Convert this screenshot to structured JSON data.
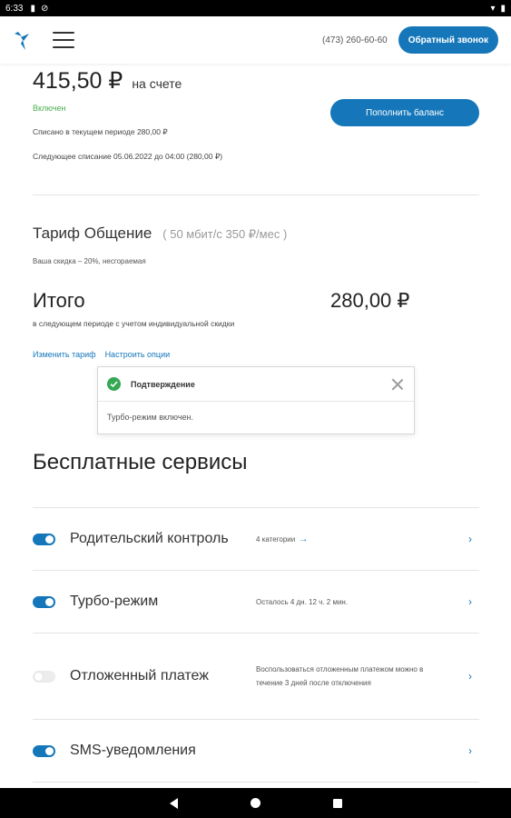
{
  "status_bar": {
    "time": "6:33"
  },
  "header": {
    "phone": "(473) 260-60-60",
    "callback_label": "Обратный звонок"
  },
  "account": {
    "balance": "415,50 ₽",
    "balance_suffix": "на счете",
    "status": "Включен",
    "charged_text": "Списано в текущем периоде 280,00 ₽",
    "next_charge_text": "Следующее списание 05.06.2022 до 04:00 (280,00 ₽)",
    "topup_label": "Пополнить баланс"
  },
  "tariff": {
    "name": "Тариф Общение",
    "spec": "( 50 мбит/с 350 ₽/мес )",
    "discount": "Ваша скидка – 20%, несгораемая",
    "total_label": "Итого",
    "total_value": "280,00 ₽",
    "total_note": "в следующем периоде с учетом индивидуальной скидки",
    "change_label": "Изменить тариф",
    "options_label": "Настроить опции"
  },
  "toast": {
    "title": "Подтверждение",
    "message": "Турбо-режим включен."
  },
  "services": {
    "title": "Бесплатные сервисы",
    "items": [
      {
        "name": "Родительский контроль",
        "info": "4 категории",
        "enabled": true
      },
      {
        "name": "Турбо-режим",
        "info": "Осталось 4 дн. 12 ч. 2 мин.",
        "enabled": true
      },
      {
        "name": "Отложенный платеж",
        "info": "Воспользоваться отложенным платежом можно в течение 3 дней после отключения",
        "enabled": false
      },
      {
        "name": "SMS-уведомления",
        "info": "",
        "enabled": true
      }
    ]
  },
  "colors": {
    "accent": "#1577ba",
    "success": "#34a853",
    "status_on": "#4caf50"
  }
}
